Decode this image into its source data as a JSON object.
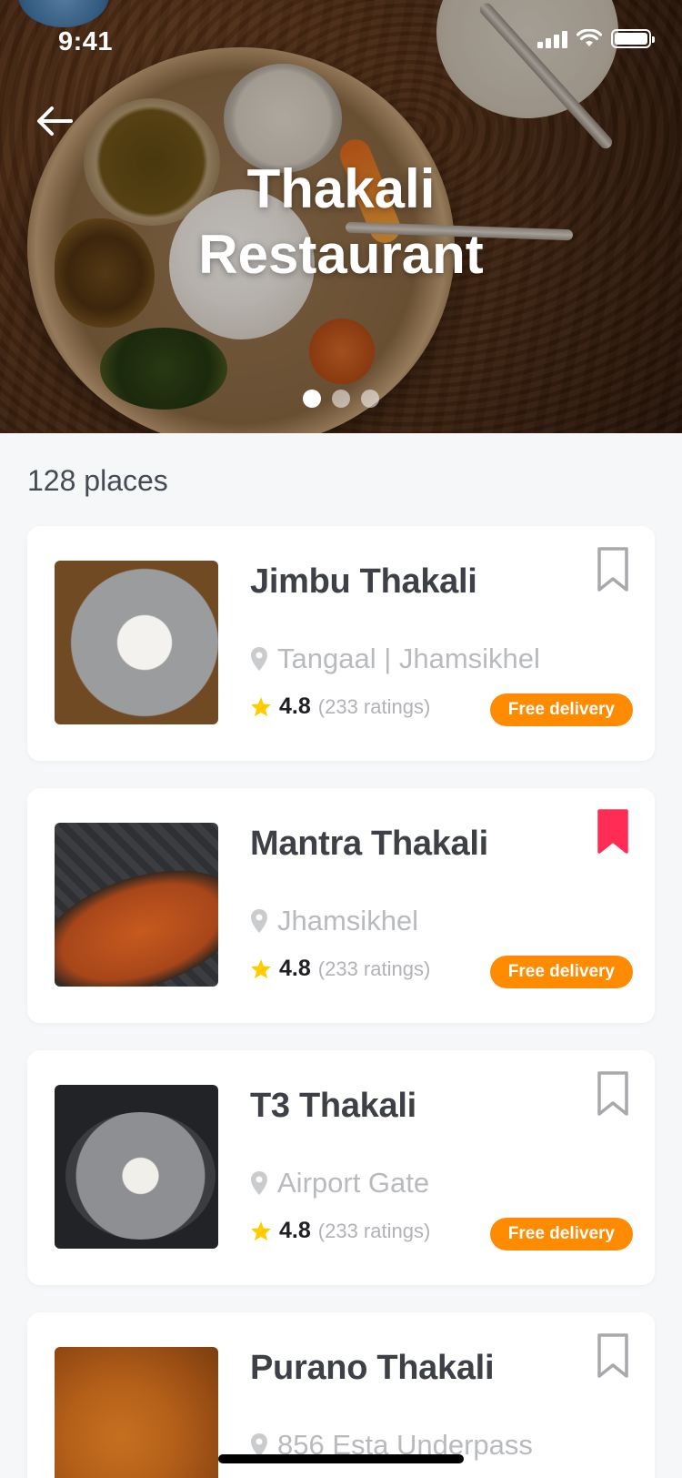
{
  "status_bar": {
    "time": "9:41"
  },
  "hero": {
    "title_line1": "Thakali",
    "title_line2": "Restaurant",
    "slides_total": 3,
    "active_slide": 1
  },
  "list": {
    "count_label": "128 places",
    "items": [
      {
        "name": "Jimbu Thakali",
        "location": "Tangaal | Jhamsikhel",
        "rating": "4.8",
        "ratings_count": "(233 ratings)",
        "badge": "Free delivery",
        "bookmarked": false
      },
      {
        "name": "Mantra Thakali",
        "location": "Jhamsikhel",
        "rating": "4.8",
        "ratings_count": "(233 ratings)",
        "badge": "Free delivery",
        "bookmarked": true
      },
      {
        "name": "T3 Thakali",
        "location": "Airport Gate",
        "rating": "4.8",
        "ratings_count": "(233 ratings)",
        "badge": "Free delivery",
        "bookmarked": false
      },
      {
        "name": "Purano Thakali",
        "location": "856 Esta Underpass",
        "rating": "",
        "ratings_count": "",
        "badge": "",
        "bookmarked": false
      }
    ]
  },
  "colors": {
    "accent_orange": "#ff8c00",
    "bookmark_active": "#ff2d55",
    "bookmark_inactive": "#a7a9ac",
    "star": "#ffcc00"
  },
  "icons": {
    "back": "arrow-left-icon",
    "location": "map-pin-icon",
    "rating": "star-icon",
    "bookmark": "bookmark-icon"
  }
}
